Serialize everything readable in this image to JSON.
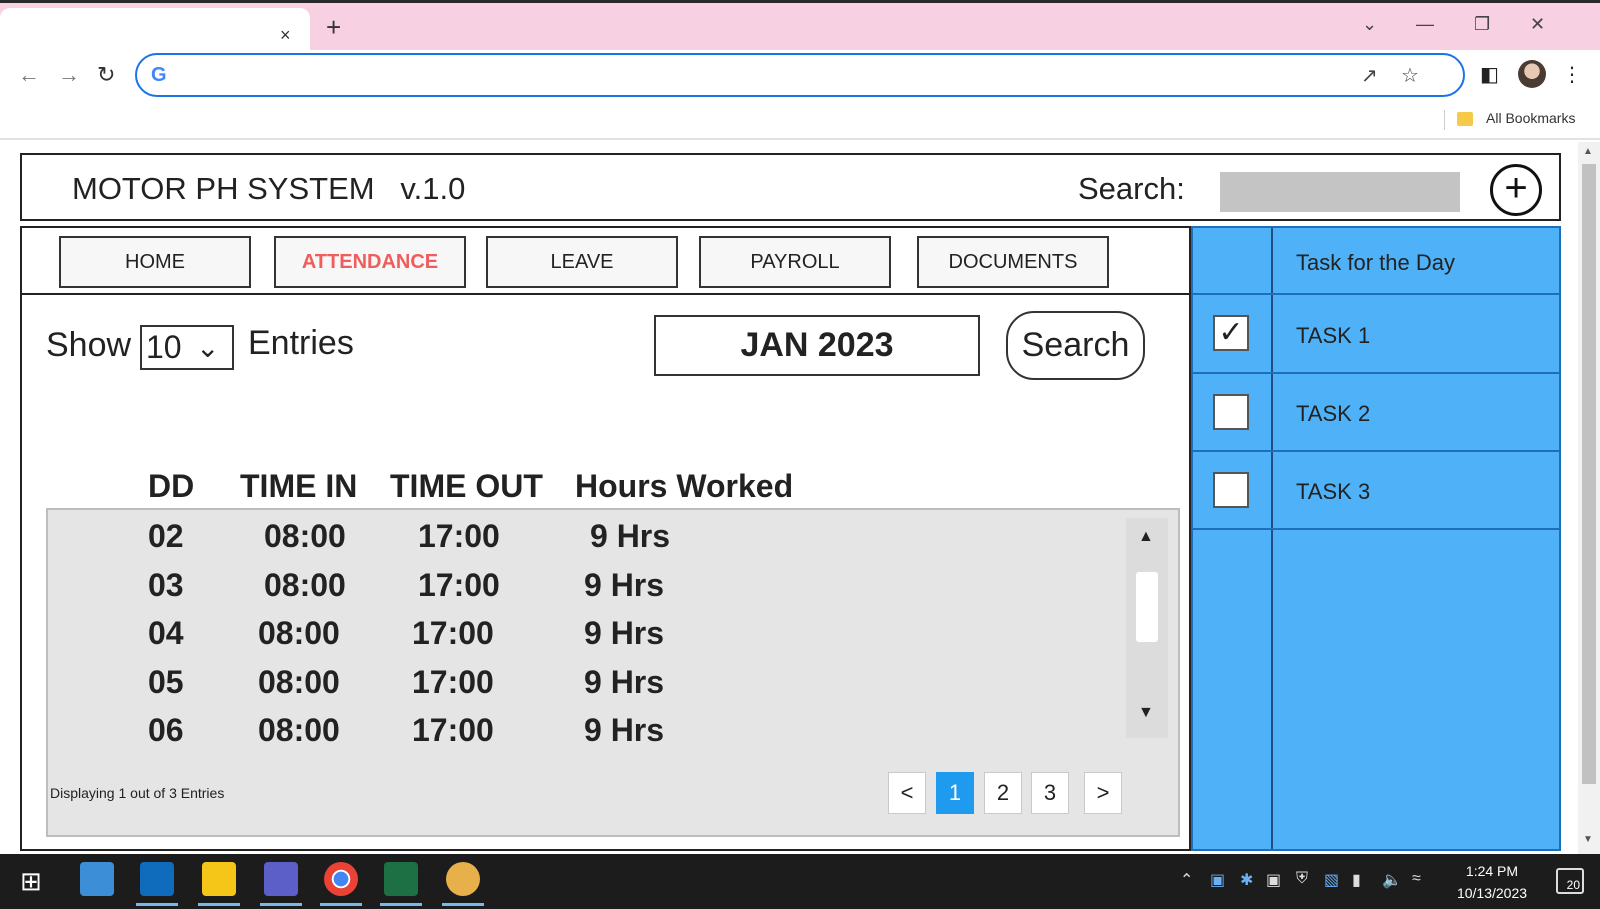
{
  "browser": {
    "new_tab_symbol": "+",
    "close_tab_symbol": "×",
    "bookmarks_label": "All Bookmarks"
  },
  "app": {
    "title": "MOTOR PH SYSTEM   v.1.0",
    "search_label": "Search:",
    "add_symbol": "+"
  },
  "nav": {
    "tabs": [
      {
        "label": "HOME",
        "active": false
      },
      {
        "label": "ATTENDANCE",
        "active": true
      },
      {
        "label": "LEAVE",
        "active": false
      },
      {
        "label": "PAYROLL",
        "active": false
      },
      {
        "label": "DOCUMENTS",
        "active": false
      }
    ]
  },
  "filters": {
    "show_label": "Show",
    "entries_value": "10",
    "entries_label": "Entries",
    "month": "JAN 2023",
    "search_button": "Search"
  },
  "table": {
    "columns": [
      "DD",
      "TIME IN",
      "TIME OUT",
      "Hours Worked"
    ],
    "rows": [
      {
        "dd": "02",
        "time_in": "08:00",
        "time_out": "17:00",
        "hours": "9 Hrs"
      },
      {
        "dd": "03",
        "time_in": "08:00",
        "time_out": "17:00",
        "hours": "9 Hrs"
      },
      {
        "dd": "04",
        "time_in": "08:00",
        "time_out": "17:00",
        "hours": "9 Hrs"
      },
      {
        "dd": "05",
        "time_in": "08:00",
        "time_out": "17:00",
        "hours": "9 Hrs"
      },
      {
        "dd": "06",
        "time_in": "08:00",
        "time_out": "17:00",
        "hours": "9 Hrs"
      }
    ],
    "footer_info": "Displaying 1 out of 3 Entries",
    "pagination": {
      "prev": "<",
      "pages": [
        "1",
        "2",
        "3"
      ],
      "current": "1",
      "next": ">"
    }
  },
  "tasks": {
    "header": "Task for the Day",
    "items": [
      {
        "label": "TASK 1",
        "checked": true,
        "mark": "✓"
      },
      {
        "label": "TASK 2",
        "checked": false,
        "mark": ""
      },
      {
        "label": "TASK 3",
        "checked": false,
        "mark": ""
      }
    ]
  },
  "taskbar": {
    "time": "1:24 PM",
    "date": "10/13/2023",
    "notification_count": "20"
  },
  "colors": {
    "accent_active_tab": "#ef5d5d",
    "task_panel": "#4fb2f8",
    "page_active": "#1e9bef",
    "browser_tabstrip": "#f7d0e2"
  }
}
